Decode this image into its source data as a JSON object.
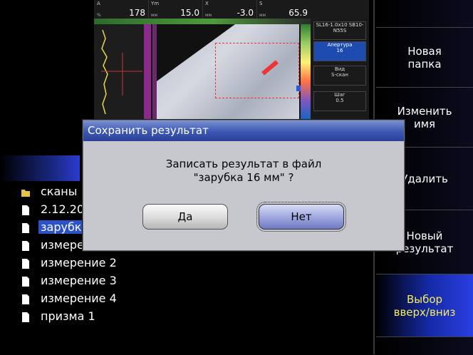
{
  "preview": {
    "cells": [
      {
        "label": "A",
        "unit": "%",
        "value": "178"
      },
      {
        "label": "Ym",
        "unit": "мм",
        "value": "15.0"
      },
      {
        "label": "X",
        "unit": "мм",
        "value": "-3.0"
      },
      {
        "label": "S",
        "unit": "мм",
        "value": "65.9"
      }
    ],
    "side": {
      "probe": "SL16-1.0x10 SB10-N55S",
      "aperture_label": "Апертура",
      "aperture_value": "16",
      "view_label": "Вид",
      "view_value": "S-скан",
      "step_label": "Шаг",
      "step_value": "0.5"
    }
  },
  "files": [
    {
      "name": "сканы",
      "type": "folder",
      "selected": false
    },
    {
      "name": "2.12.20",
      "type": "file",
      "selected": false
    },
    {
      "name": "зарубка",
      "type": "file",
      "selected": true
    },
    {
      "name": "измерен",
      "type": "file",
      "selected": false
    },
    {
      "name": "измерение 2",
      "type": "file",
      "selected": false
    },
    {
      "name": "измерение 3",
      "type": "file",
      "selected": false
    },
    {
      "name": "измерение 4",
      "type": "file",
      "selected": false
    },
    {
      "name": "призма 1",
      "type": "file",
      "selected": false
    }
  ],
  "softkeys": {
    "new_folder": "Новая\nпапка",
    "rename": "Изменить\nимя",
    "delete": "Удалить",
    "new_result": "Новый\nрезультат",
    "select_up_down": "Выбор\nвверх/вниз"
  },
  "dialog": {
    "title": "Сохранить результат",
    "message_line1": "Записать результат в файл",
    "message_line2": "\"зарубка 16 мм\" ?",
    "yes_label": "Да",
    "no_label": "Нет"
  },
  "colors": {
    "selection": "#2b52c8",
    "active_softkey_text": "#f4ec5c",
    "folder_icon": "#e6c24a"
  }
}
